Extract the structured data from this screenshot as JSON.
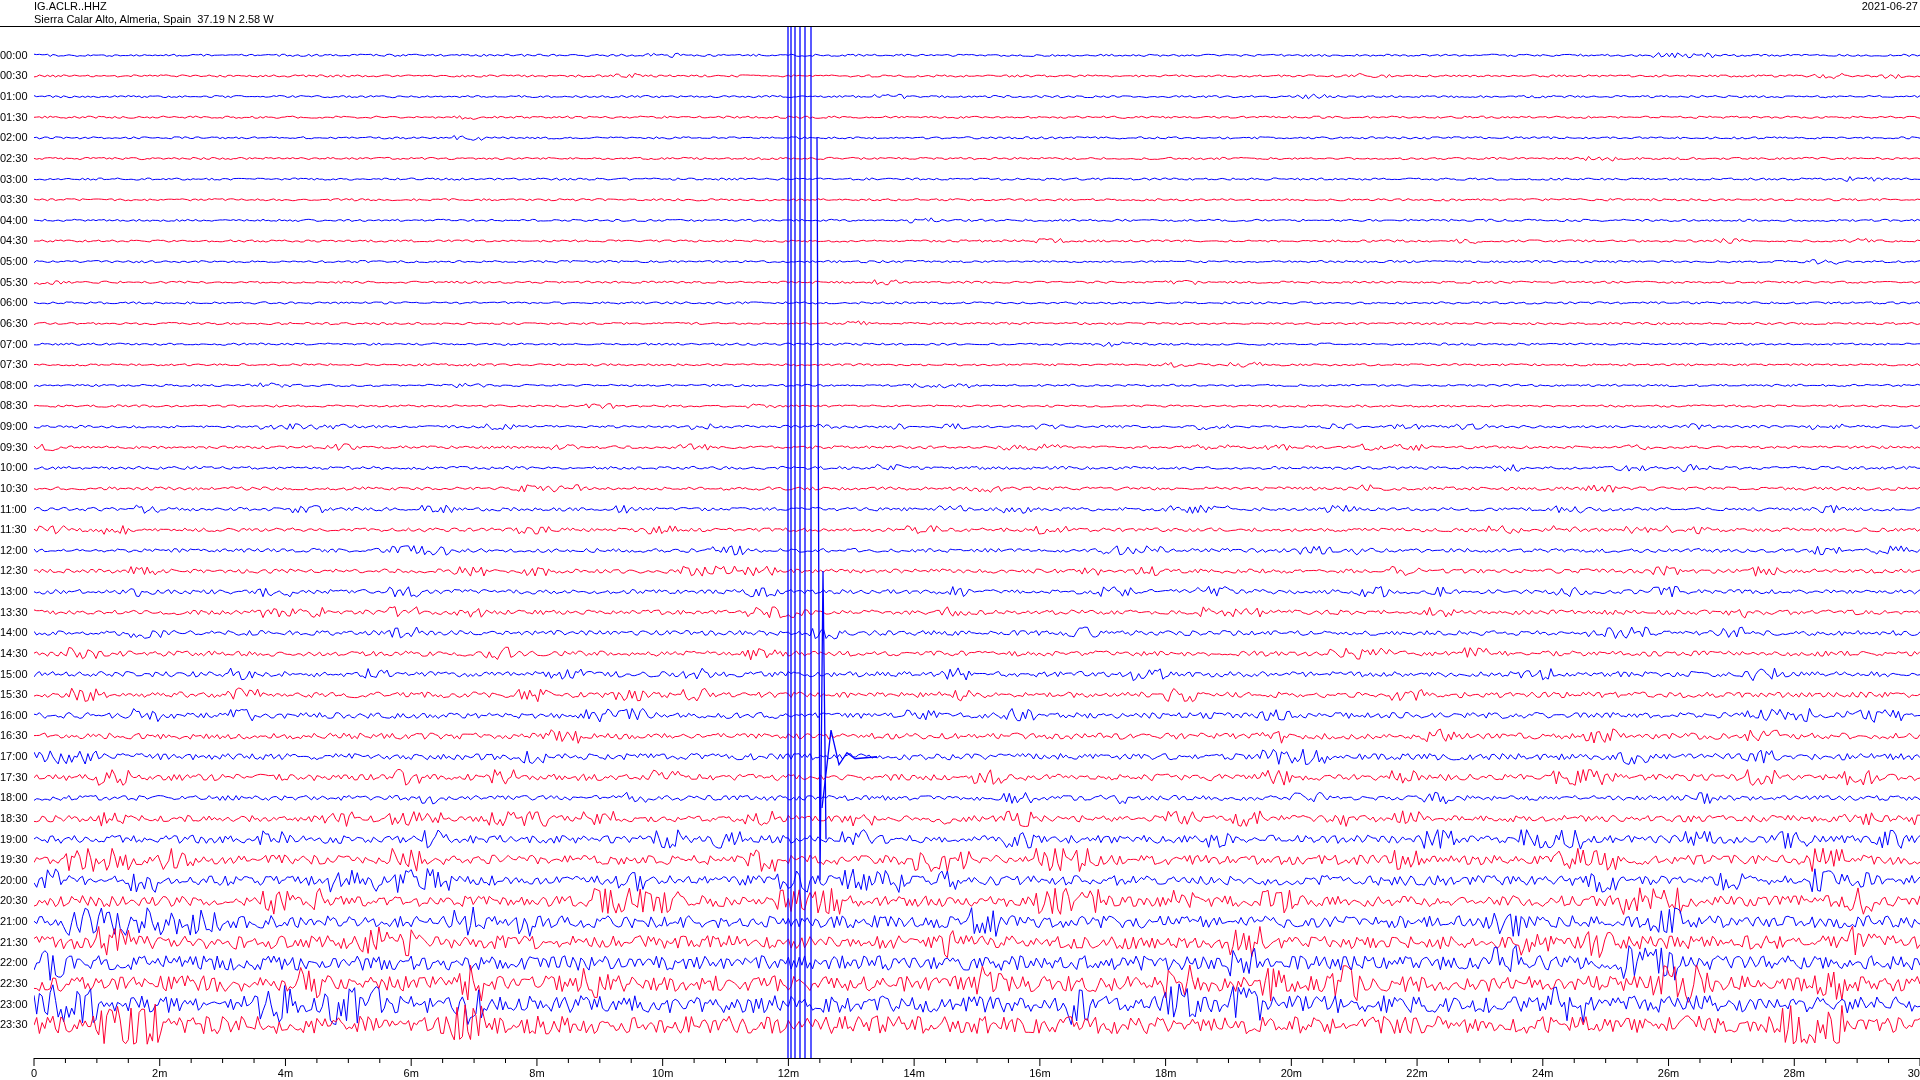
{
  "header": {
    "station": "IG.ACLR..HHZ",
    "location": "Sierra Calar Alto, Almeria, Spain  37.19 N 2.58 W",
    "date": "2021-06-27"
  },
  "rows": [
    {
      "label": "00:00",
      "color": "#0000ff"
    },
    {
      "label": "00:30",
      "color": "#ff0033"
    },
    {
      "label": "01:00",
      "color": "#0000ff"
    },
    {
      "label": "01:30",
      "color": "#ff0033"
    },
    {
      "label": "02:00",
      "color": "#0000ff"
    },
    {
      "label": "02:30",
      "color": "#ff0033"
    },
    {
      "label": "03:00",
      "color": "#0000ff"
    },
    {
      "label": "03:30",
      "color": "#ff0033"
    },
    {
      "label": "04:00",
      "color": "#0000ff"
    },
    {
      "label": "04:30",
      "color": "#ff0033"
    },
    {
      "label": "05:00",
      "color": "#0000ff"
    },
    {
      "label": "05:30",
      "color": "#ff0033"
    },
    {
      "label": "06:00",
      "color": "#0000ff"
    },
    {
      "label": "06:30",
      "color": "#ff0033"
    },
    {
      "label": "07:00",
      "color": "#0000ff"
    },
    {
      "label": "07:30",
      "color": "#ff0033"
    },
    {
      "label": "08:00",
      "color": "#0000ff"
    },
    {
      "label": "08:30",
      "color": "#ff0033"
    },
    {
      "label": "09:00",
      "color": "#0000ff"
    },
    {
      "label": "09:30",
      "color": "#ff0033"
    },
    {
      "label": "10:00",
      "color": "#0000ff"
    },
    {
      "label": "10:30",
      "color": "#ff0033"
    },
    {
      "label": "11:00",
      "color": "#0000ff"
    },
    {
      "label": "11:30",
      "color": "#ff0033"
    },
    {
      "label": "12:00",
      "color": "#0000ff"
    },
    {
      "label": "12:30",
      "color": "#ff0033"
    },
    {
      "label": "13:00",
      "color": "#0000ff"
    },
    {
      "label": "13:30",
      "color": "#ff0033"
    },
    {
      "label": "14:00",
      "color": "#0000ff"
    },
    {
      "label": "14:30",
      "color": "#ff0033"
    },
    {
      "label": "15:00",
      "color": "#0000ff"
    },
    {
      "label": "15:30",
      "color": "#ff0033"
    },
    {
      "label": "16:00",
      "color": "#0000ff"
    },
    {
      "label": "16:30",
      "color": "#ff0033"
    },
    {
      "label": "17:00",
      "color": "#0000ff"
    },
    {
      "label": "17:30",
      "color": "#ff0033"
    },
    {
      "label": "18:00",
      "color": "#0000ff"
    },
    {
      "label": "18:30",
      "color": "#ff0033"
    },
    {
      "label": "19:00",
      "color": "#0000ff"
    },
    {
      "label": "19:30",
      "color": "#ff0033"
    },
    {
      "label": "20:00",
      "color": "#0000ff"
    },
    {
      "label": "20:30",
      "color": "#ff0033"
    },
    {
      "label": "21:00",
      "color": "#0000ff"
    },
    {
      "label": "21:30",
      "color": "#ff0033"
    },
    {
      "label": "22:00",
      "color": "#0000ff"
    },
    {
      "label": "22:30",
      "color": "#ff0033"
    },
    {
      "label": "23:00",
      "color": "#0000ff"
    },
    {
      "label": "23:30",
      "color": "#ff0033"
    }
  ],
  "x_axis": {
    "ticks": [
      "0",
      "2m",
      "4m",
      "6m",
      "8m",
      "10m",
      "12m",
      "14m",
      "16m",
      "18m",
      "20m",
      "22m",
      "24m",
      "26m",
      "28m",
      "30"
    ]
  }
}
